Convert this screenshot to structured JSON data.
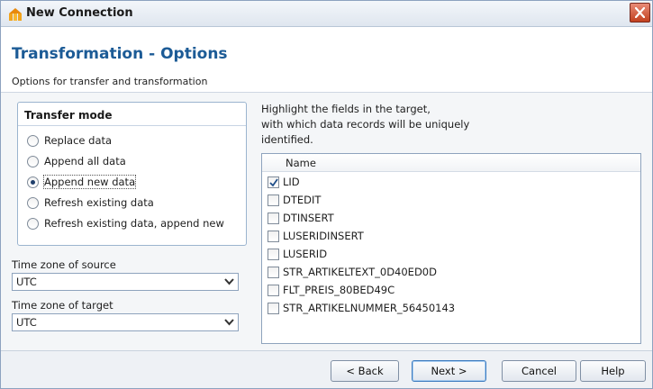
{
  "window": {
    "title": "New Connection"
  },
  "header": {
    "title": "Transformation - Options",
    "subtitle": "Options for transfer and transformation"
  },
  "transfer_mode": {
    "title": "Transfer mode",
    "options": [
      {
        "label": "Replace data",
        "selected": false
      },
      {
        "label": "Append all data",
        "selected": false
      },
      {
        "label": "Append new data",
        "selected": true
      },
      {
        "label": "Refresh existing data",
        "selected": false
      },
      {
        "label": "Refresh existing data, append new",
        "selected": false
      }
    ]
  },
  "timezone": {
    "source_label": "Time zone of source",
    "source_value": "UTC",
    "target_label": "Time zone of target",
    "target_value": "UTC"
  },
  "fields": {
    "hint_line1": "Highlight the fields in the target,",
    "hint_line2": "with which data records will be uniquely",
    "hint_line3": "identified.",
    "column_header": "Name",
    "items": [
      {
        "label": "LID",
        "checked": true
      },
      {
        "label": "DTEDIT",
        "checked": false
      },
      {
        "label": "DTINSERT",
        "checked": false
      },
      {
        "label": "LUSERIDINSERT",
        "checked": false
      },
      {
        "label": "LUSERID",
        "checked": false
      },
      {
        "label": "STR_ARTIKELTEXT_0D40ED0D",
        "checked": false
      },
      {
        "label": "FLT_PREIS_80BED49C",
        "checked": false
      },
      {
        "label": "STR_ARTIKELNUMMER_56450143",
        "checked": false
      }
    ]
  },
  "buttons": {
    "back": "< Back",
    "next": "Next >",
    "cancel": "Cancel",
    "help": "Help"
  },
  "colors": {
    "accent": "#1c5b96",
    "close": "#c2411f",
    "app_icon": "#f2a41b"
  },
  "icons": {
    "app": "app-logo-icon",
    "close": "close-icon",
    "dropdown": "chevron-down-icon",
    "check": "checkmark-icon"
  }
}
